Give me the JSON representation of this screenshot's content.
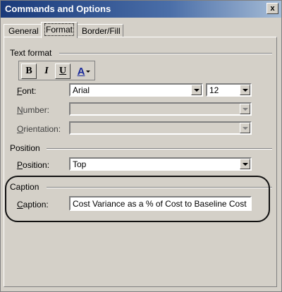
{
  "window": {
    "title": "Commands and Options",
    "close_glyph": "x"
  },
  "tabs": [
    {
      "label": "General",
      "active": false
    },
    {
      "label": "Format",
      "active": true
    },
    {
      "label": "Border/Fill",
      "active": false
    }
  ],
  "text_format": {
    "group_label": "Text format",
    "buttons": [
      {
        "label": "B",
        "pressed": true
      },
      {
        "label": "I",
        "pressed": false
      },
      {
        "label": "U",
        "pressed": true
      }
    ],
    "font_color_glyph": "A",
    "font_color": "#1a2a9a",
    "font": {
      "mnemonic": "F",
      "rest": "ont:",
      "value": "Arial"
    },
    "font_size": {
      "value": "12"
    },
    "number": {
      "mnemonic": "N",
      "rest": "umber:",
      "value": "",
      "disabled": true
    },
    "orientation": {
      "mnemonic": "O",
      "rest": "rientation:",
      "value": "",
      "disabled": true
    }
  },
  "position": {
    "group_label": "Position",
    "field": {
      "mnemonic": "P",
      "rest": "osition:",
      "value": "Top"
    }
  },
  "caption": {
    "group_label": "Caption",
    "field": {
      "mnemonic": "C",
      "rest": "aption:",
      "value": "Cost Variance as a % of Cost to Baseline Cost"
    }
  }
}
